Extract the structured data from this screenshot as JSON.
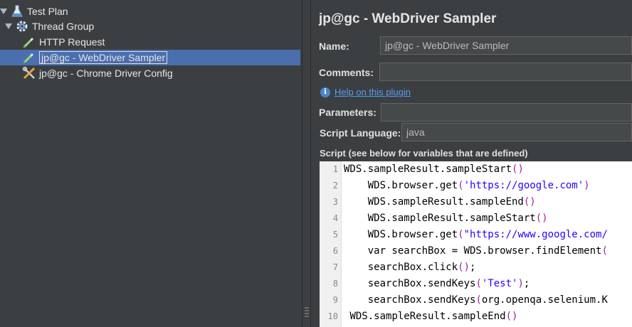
{
  "tree": {
    "items": [
      {
        "label": "Test Plan",
        "icon": "flask-icon",
        "level": 0,
        "expanded": true
      },
      {
        "label": "Thread Group",
        "icon": "gear-icon",
        "level": 1,
        "expanded": true
      },
      {
        "label": "HTTP Request",
        "icon": "pipette-icon",
        "level": 2
      },
      {
        "label": "jp@gc - WebDriver Sampler",
        "icon": "pipette-icon",
        "level": 2,
        "selected": true
      },
      {
        "label": "jp@gc - Chrome Driver Config",
        "icon": "tools-icon",
        "level": 2
      }
    ]
  },
  "panel": {
    "title": "jp@gc - WebDriver Sampler",
    "name_label": "Name:",
    "name_value": "jp@gc - WebDriver Sampler",
    "comments_label": "Comments:",
    "comments_value": "",
    "help_link": "Help on this plugin",
    "parameters_label": "Parameters:",
    "parameters_value": "",
    "script_language_label": "Script Language:",
    "script_language_value": "java",
    "script_label": "Script (see below for variables that are defined)"
  },
  "script": {
    "lines": [
      {
        "n": "1",
        "indent": "",
        "parts": [
          [
            "c",
            "WDS.sampleResult.sampleStart"
          ],
          [
            "p",
            "()"
          ]
        ]
      },
      {
        "n": "2",
        "indent": "    ",
        "parts": [
          [
            "c",
            "WDS.browser.get"
          ],
          [
            "p",
            "("
          ],
          [
            "s",
            "'https://google.com'"
          ],
          [
            "p",
            ")"
          ]
        ]
      },
      {
        "n": "3",
        "indent": "    ",
        "parts": [
          [
            "c",
            "WDS.sampleResult.sampleEnd"
          ],
          [
            "p",
            "()"
          ]
        ]
      },
      {
        "n": "4",
        "indent": "    ",
        "parts": [
          [
            "c",
            "WDS.sampleResult.sampleStart"
          ],
          [
            "p",
            "()"
          ]
        ]
      },
      {
        "n": "5",
        "indent": "    ",
        "parts": [
          [
            "c",
            "WDS.browser.get"
          ],
          [
            "p",
            "("
          ],
          [
            "s",
            "\"https://www.google.com/"
          ]
        ]
      },
      {
        "n": "6",
        "indent": "    ",
        "parts": [
          [
            "c",
            "var searchBox = WDS.browser.findElement"
          ],
          [
            "p",
            "("
          ]
        ]
      },
      {
        "n": "7",
        "indent": "    ",
        "parts": [
          [
            "c",
            "searchBox.click"
          ],
          [
            "p",
            "()"
          ],
          [
            "c",
            ";"
          ]
        ]
      },
      {
        "n": "8",
        "indent": "    ",
        "parts": [
          [
            "c",
            "searchBox.sendKeys"
          ],
          [
            "p",
            "("
          ],
          [
            "s",
            "'Test'"
          ],
          [
            "p",
            ")"
          ],
          [
            "c",
            ";"
          ]
        ]
      },
      {
        "n": "9",
        "indent": "    ",
        "parts": [
          [
            "c",
            "searchBox.sendKeys"
          ],
          [
            "p",
            "("
          ],
          [
            "c",
            "org.openqa.selenium.K"
          ]
        ]
      },
      {
        "n": "10",
        "indent": " ",
        "parts": [
          [
            "c",
            "WDS.sampleResult.sampleEnd"
          ],
          [
            "p",
            "()"
          ]
        ]
      }
    ]
  }
}
